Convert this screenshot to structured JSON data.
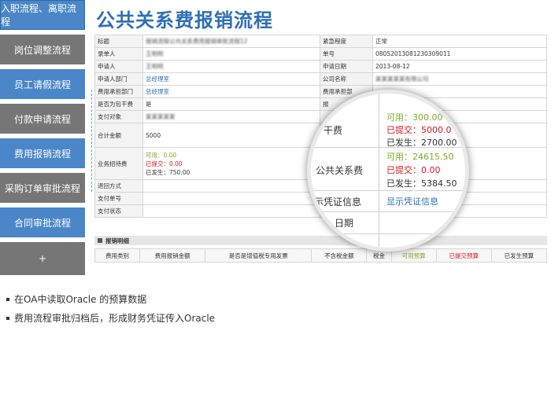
{
  "nav": {
    "items": [
      {
        "label": "入职流程、离职流程"
      },
      {
        "label": "岗位调整流程"
      },
      {
        "label": "员工请假流程"
      },
      {
        "label": "付款申请流程"
      },
      {
        "label": "费用报销流程"
      },
      {
        "label": "采购订单审批流程"
      },
      {
        "label": "合同审批流程"
      },
      {
        "label": "+"
      }
    ]
  },
  "page": {
    "title": "公共关系费报销流程"
  },
  "form": {
    "rows": [
      {
        "l1": "标题",
        "v1": "报销流程公共关系费用报销审批流程12",
        "l2": "紧急程度",
        "v2": "正常"
      },
      {
        "l1": "录单人",
        "v1": "王明明",
        "l2": "单号",
        "v2": "0805201308123030901​1"
      },
      {
        "l1": "申请人",
        "v1": "王明明",
        "l2": "申请日期",
        "v2": "2013-08-12"
      },
      {
        "l1": "申请人部门",
        "v1": "总经理室",
        "l2": "公司名称",
        "v2": "某某某某某有限公司"
      },
      {
        "l1": "费用承担部门",
        "v1": "总经理室",
        "l2": "费用承担部",
        "v2": ""
      },
      {
        "l1": "是否为包干费",
        "v1": "是",
        "l2": "报",
        "v2": ""
      },
      {
        "l1": "支付对象",
        "v1": "某某某某某",
        "l2": "",
        "v2": ""
      }
    ],
    "total_label": "合计金额",
    "total_value": "5000",
    "entertain_label": "业务招待费",
    "entertain_available": "可用：0.00",
    "entertain_submitted": "已提交：0.00",
    "entertain_occurred": "已发生：750.00",
    "refund_label": "退回方式",
    "paynum_label": "支付单号",
    "paystatus_label": "支付状态"
  },
  "magnifier": {
    "row1_label": "干费",
    "row1_available": "可用：300.00",
    "row1_submitted": "已提交：5000.0",
    "row1_occurred": "已发生：2700.00",
    "row2_label": "公共关系费",
    "row2_available": "可用：24615.50",
    "row2_submitted": "已提交：0.00",
    "row2_occurred": "已发生：5384.50",
    "row3_label": "示凭证信息",
    "row3_link": "显示凭证信息",
    "row4_label": "日期"
  },
  "detail": {
    "bar_title": "报销明细",
    "headers": [
      "费用类别",
      "费用报销金额",
      "是否是增值税专用发票",
      "不含税金额",
      "税金",
      "可用预算",
      "已提交预算",
      "已发生预算"
    ]
  },
  "bullets": [
    "在OA中读取Oracle 的预算数据",
    "费用流程审批归档后，形成财务凭证传入Oracle"
  ],
  "colors": {
    "nav_blue": "#4a86c8",
    "nav_gray": "#767676",
    "title_blue": "#2e6fb7",
    "available_green": "#7cab23",
    "submitted_red": "#d8171e"
  }
}
